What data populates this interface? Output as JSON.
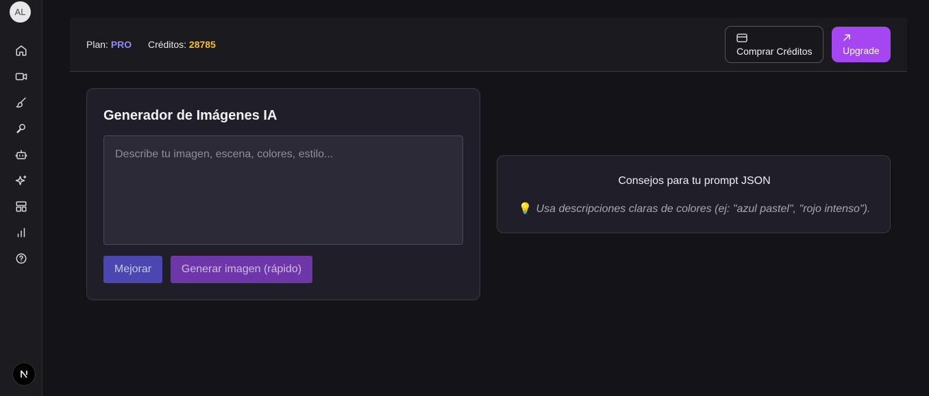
{
  "user": {
    "initials": "AL"
  },
  "sidebar": {
    "items": [
      {
        "icon": "home-icon"
      },
      {
        "icon": "video-icon"
      },
      {
        "icon": "brush-icon"
      },
      {
        "icon": "microphone-icon"
      },
      {
        "icon": "bot-icon"
      },
      {
        "icon": "sparkles-icon"
      },
      {
        "icon": "layout-icon"
      },
      {
        "icon": "chart-icon"
      },
      {
        "icon": "help-icon"
      }
    ]
  },
  "header": {
    "plan_label": "Plan:",
    "plan_value": "PRO",
    "credits_label": "Créditos:",
    "credits_value": "28785",
    "buy_label": "Comprar Créditos",
    "upgrade_label": "Upgrade"
  },
  "generator": {
    "title": "Generador de Imágenes IA",
    "prompt_placeholder": "Describe tu imagen, escena, colores, estilo...",
    "prompt_value": "",
    "improve_label": "Mejorar",
    "generate_label": "Generar imagen (rápido)"
  },
  "tips": {
    "title": "Consejos para tu prompt JSON",
    "bulb": "💡",
    "text": "Usa descripciones claras de colores (ej: \"azul pastel\", \"rojo intenso\")."
  },
  "colors": {
    "accent": "#a546f2",
    "plan": "#8b8cf8",
    "credits": "#f6c02c"
  }
}
